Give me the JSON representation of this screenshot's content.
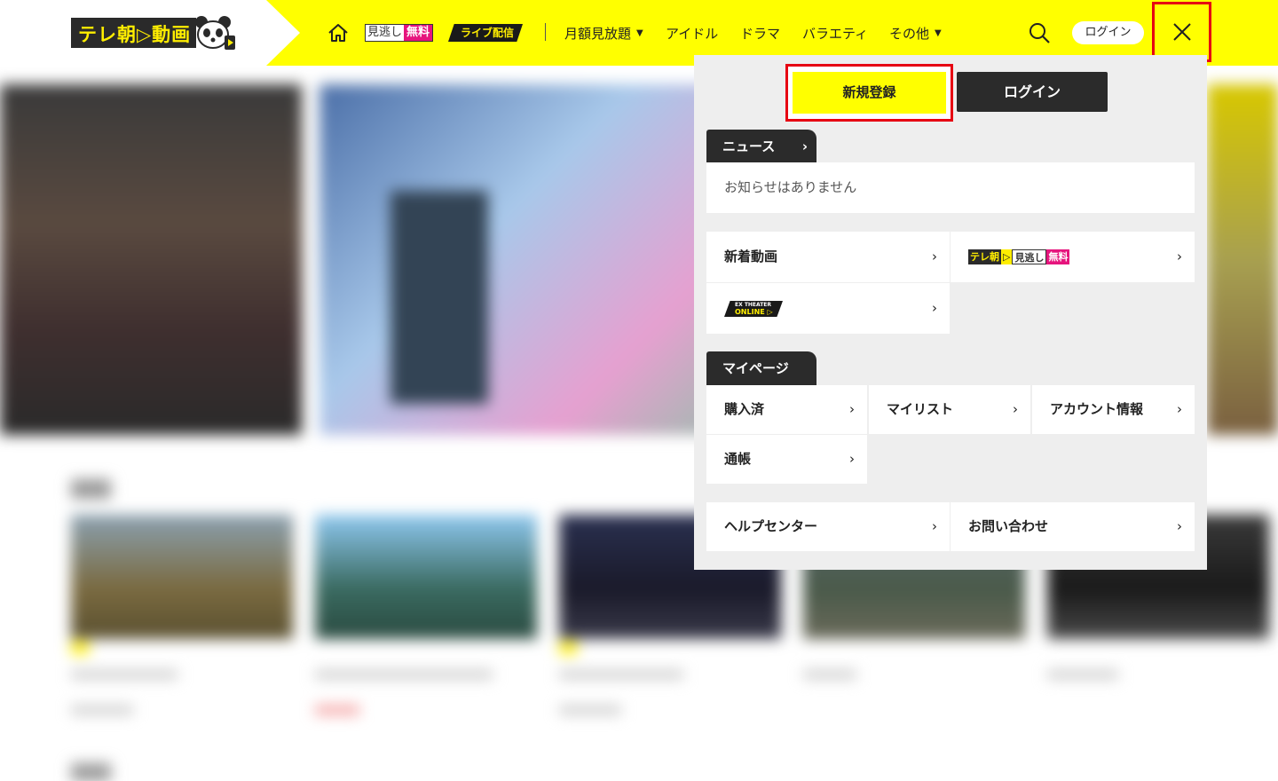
{
  "header": {
    "logo_text": "テレ朝▷動画",
    "nav": {
      "miru_a": "見逃し",
      "miru_b": "無料",
      "live": "ライブ配信",
      "monthly": "月額見放題",
      "idol": "アイドル",
      "drama": "ドラマ",
      "variety": "バラエティ",
      "other": "その他"
    },
    "login_label": "ログイン"
  },
  "menu": {
    "register_label": "新規登録",
    "login_label": "ログイン",
    "news_tab": "ニュース",
    "news_empty": "お知らせはありません",
    "links": {
      "new_videos": "新着動画",
      "miru_logo_a": "テレ朝",
      "miru_logo_b": "▷",
      "miru_logo_c": "見逃し",
      "miru_logo_d": "無料",
      "ex_theater_top": "EX THEATER",
      "ex_theater_bottom": "ONLINE ▷"
    },
    "mypage_tab": "マイページ",
    "mypage": {
      "purchased": "購入済",
      "mylist": "マイリスト",
      "account": "アカウント情報",
      "passbook": "通帳"
    },
    "help": "ヘルプセンター",
    "contact": "お問い合わせ"
  },
  "icons": {
    "arrow": "›",
    "caret": "⌄"
  },
  "colors": {
    "brand_yellow": "#ffff00",
    "highlight_red": "#e60012",
    "dark": "#2b2b2b",
    "pink": "#e6147d"
  }
}
